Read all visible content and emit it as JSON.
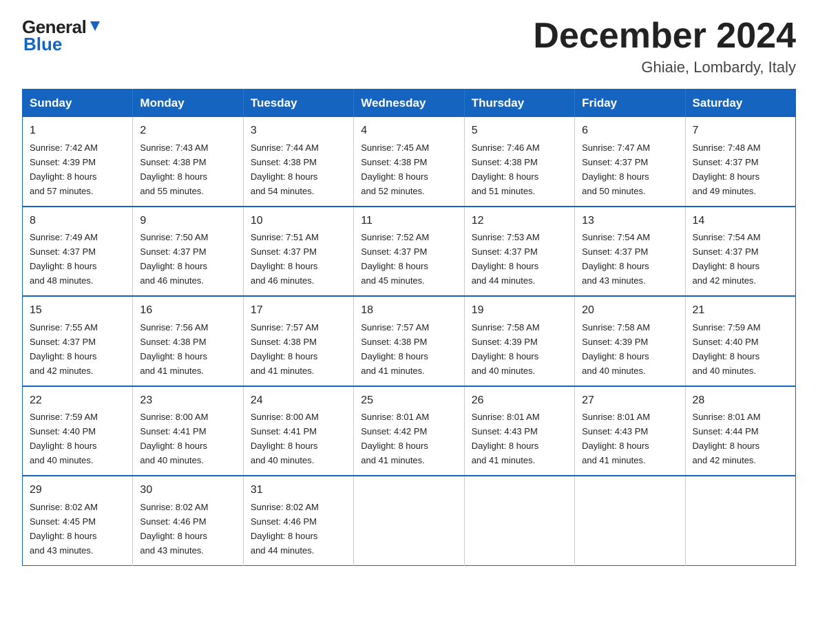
{
  "header": {
    "logo_general": "General",
    "logo_blue": "Blue",
    "month_title": "December 2024",
    "location": "Ghiaie, Lombardy, Italy"
  },
  "days_of_week": [
    "Sunday",
    "Monday",
    "Tuesday",
    "Wednesday",
    "Thursday",
    "Friday",
    "Saturday"
  ],
  "weeks": [
    [
      {
        "day": "1",
        "sunrise": "7:42 AM",
        "sunset": "4:39 PM",
        "daylight": "8 hours and 57 minutes."
      },
      {
        "day": "2",
        "sunrise": "7:43 AM",
        "sunset": "4:38 PM",
        "daylight": "8 hours and 55 minutes."
      },
      {
        "day": "3",
        "sunrise": "7:44 AM",
        "sunset": "4:38 PM",
        "daylight": "8 hours and 54 minutes."
      },
      {
        "day": "4",
        "sunrise": "7:45 AM",
        "sunset": "4:38 PM",
        "daylight": "8 hours and 52 minutes."
      },
      {
        "day": "5",
        "sunrise": "7:46 AM",
        "sunset": "4:38 PM",
        "daylight": "8 hours and 51 minutes."
      },
      {
        "day": "6",
        "sunrise": "7:47 AM",
        "sunset": "4:37 PM",
        "daylight": "8 hours and 50 minutes."
      },
      {
        "day": "7",
        "sunrise": "7:48 AM",
        "sunset": "4:37 PM",
        "daylight": "8 hours and 49 minutes."
      }
    ],
    [
      {
        "day": "8",
        "sunrise": "7:49 AM",
        "sunset": "4:37 PM",
        "daylight": "8 hours and 48 minutes."
      },
      {
        "day": "9",
        "sunrise": "7:50 AM",
        "sunset": "4:37 PM",
        "daylight": "8 hours and 46 minutes."
      },
      {
        "day": "10",
        "sunrise": "7:51 AM",
        "sunset": "4:37 PM",
        "daylight": "8 hours and 46 minutes."
      },
      {
        "day": "11",
        "sunrise": "7:52 AM",
        "sunset": "4:37 PM",
        "daylight": "8 hours and 45 minutes."
      },
      {
        "day": "12",
        "sunrise": "7:53 AM",
        "sunset": "4:37 PM",
        "daylight": "8 hours and 44 minutes."
      },
      {
        "day": "13",
        "sunrise": "7:54 AM",
        "sunset": "4:37 PM",
        "daylight": "8 hours and 43 minutes."
      },
      {
        "day": "14",
        "sunrise": "7:54 AM",
        "sunset": "4:37 PM",
        "daylight": "8 hours and 42 minutes."
      }
    ],
    [
      {
        "day": "15",
        "sunrise": "7:55 AM",
        "sunset": "4:37 PM",
        "daylight": "8 hours and 42 minutes."
      },
      {
        "day": "16",
        "sunrise": "7:56 AM",
        "sunset": "4:38 PM",
        "daylight": "8 hours and 41 minutes."
      },
      {
        "day": "17",
        "sunrise": "7:57 AM",
        "sunset": "4:38 PM",
        "daylight": "8 hours and 41 minutes."
      },
      {
        "day": "18",
        "sunrise": "7:57 AM",
        "sunset": "4:38 PM",
        "daylight": "8 hours and 41 minutes."
      },
      {
        "day": "19",
        "sunrise": "7:58 AM",
        "sunset": "4:39 PM",
        "daylight": "8 hours and 40 minutes."
      },
      {
        "day": "20",
        "sunrise": "7:58 AM",
        "sunset": "4:39 PM",
        "daylight": "8 hours and 40 minutes."
      },
      {
        "day": "21",
        "sunrise": "7:59 AM",
        "sunset": "4:40 PM",
        "daylight": "8 hours and 40 minutes."
      }
    ],
    [
      {
        "day": "22",
        "sunrise": "7:59 AM",
        "sunset": "4:40 PM",
        "daylight": "8 hours and 40 minutes."
      },
      {
        "day": "23",
        "sunrise": "8:00 AM",
        "sunset": "4:41 PM",
        "daylight": "8 hours and 40 minutes."
      },
      {
        "day": "24",
        "sunrise": "8:00 AM",
        "sunset": "4:41 PM",
        "daylight": "8 hours and 40 minutes."
      },
      {
        "day": "25",
        "sunrise": "8:01 AM",
        "sunset": "4:42 PM",
        "daylight": "8 hours and 41 minutes."
      },
      {
        "day": "26",
        "sunrise": "8:01 AM",
        "sunset": "4:43 PM",
        "daylight": "8 hours and 41 minutes."
      },
      {
        "day": "27",
        "sunrise": "8:01 AM",
        "sunset": "4:43 PM",
        "daylight": "8 hours and 41 minutes."
      },
      {
        "day": "28",
        "sunrise": "8:01 AM",
        "sunset": "4:44 PM",
        "daylight": "8 hours and 42 minutes."
      }
    ],
    [
      {
        "day": "29",
        "sunrise": "8:02 AM",
        "sunset": "4:45 PM",
        "daylight": "8 hours and 43 minutes."
      },
      {
        "day": "30",
        "sunrise": "8:02 AM",
        "sunset": "4:46 PM",
        "daylight": "8 hours and 43 minutes."
      },
      {
        "day": "31",
        "sunrise": "8:02 AM",
        "sunset": "4:46 PM",
        "daylight": "8 hours and 44 minutes."
      },
      null,
      null,
      null,
      null
    ]
  ],
  "labels": {
    "sunrise": "Sunrise:",
    "sunset": "Sunset:",
    "daylight": "Daylight:"
  }
}
